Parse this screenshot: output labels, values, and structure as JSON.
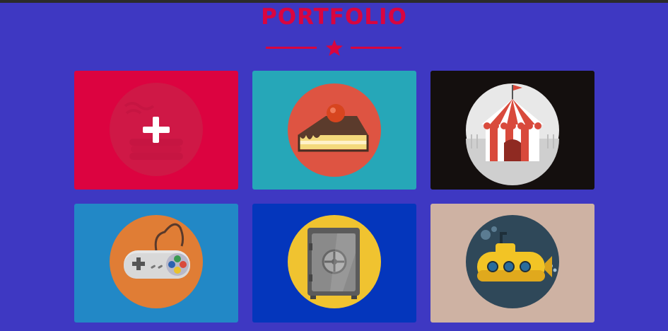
{
  "header": {
    "title": "PORTFOLIO",
    "divider_icon": "star-icon"
  },
  "colors": {
    "page_background": "#3e38c2",
    "accent": "#d9053f"
  },
  "portfolio": {
    "items": [
      {
        "icon": "pancakes-icon",
        "background": "#dc0340",
        "hover_state": true,
        "overlay_icon": "plus-icon"
      },
      {
        "icon": "cake-slice-icon",
        "background": "#26a7b8"
      },
      {
        "icon": "circus-tent-icon",
        "background": "#140f0e"
      },
      {
        "icon": "gamepad-icon",
        "background": "#2288c6"
      },
      {
        "icon": "safe-icon",
        "background": "#0436bc"
      },
      {
        "icon": "submarine-icon",
        "background": "#ceb2a3"
      }
    ]
  }
}
